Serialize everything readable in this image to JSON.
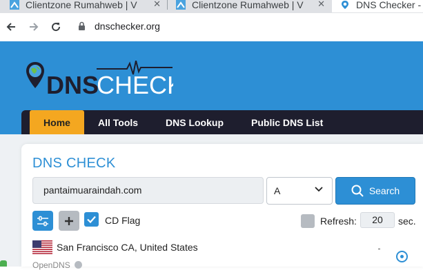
{
  "browser": {
    "tabs": [
      {
        "title": "Clientzone Rumahweb | V"
      },
      {
        "title": "Clientzone Rumahweb | V"
      },
      {
        "title": "DNS Checker - D"
      }
    ],
    "url": "dnschecker.org"
  },
  "site": {
    "logo_left": "DNS",
    "logo_right": "CHECKER",
    "nav": [
      "Home",
      "All Tools",
      "DNS Lookup",
      "Public DNS List"
    ]
  },
  "dns_check": {
    "title": "DNS CHECK",
    "domain_value": "pantaimuaraindah.com",
    "record_type": "A",
    "search_label": "Search",
    "cd_flag_label": "CD Flag",
    "refresh_label": "Refresh:",
    "refresh_value": "20",
    "refresh_unit": "sec."
  },
  "results": [
    {
      "location": "San Francisco CA, United States",
      "provider": "OpenDNS",
      "status": "-"
    }
  ],
  "colors": {
    "brand_blue": "#2d8fd5",
    "nav_dark": "#1e1e2e",
    "home_orange": "#f4a720"
  }
}
